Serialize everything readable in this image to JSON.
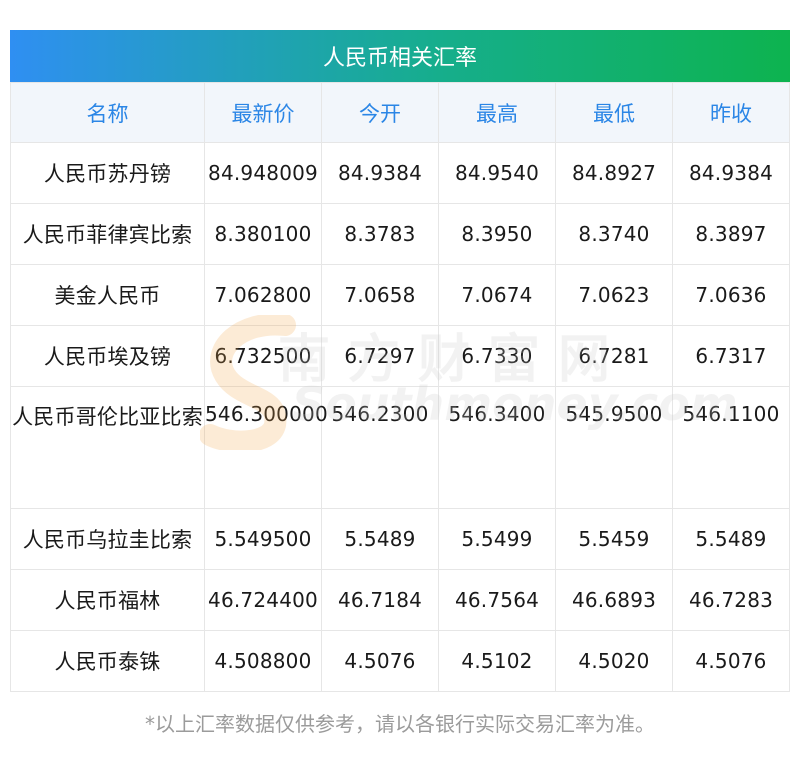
{
  "title": "人民币相关汇率",
  "columns": [
    "名称",
    "最新价",
    "今开",
    "最高",
    "最低",
    "昨收"
  ],
  "rows": [
    {
      "name": "人民币苏丹镑",
      "latest": "84.948009",
      "open": "84.9384",
      "high": "84.9540",
      "low": "84.8927",
      "prev_close": "84.9384"
    },
    {
      "name": "人民币菲律宾比索",
      "latest": "8.380100",
      "open": "8.3783",
      "high": "8.3950",
      "low": "8.3740",
      "prev_close": "8.3897"
    },
    {
      "name": "美金人民币",
      "latest": "7.062800",
      "open": "7.0658",
      "high": "7.0674",
      "low": "7.0623",
      "prev_close": "7.0636"
    },
    {
      "name": "人民币埃及镑",
      "latest": "6.732500",
      "open": "6.7297",
      "high": "6.7330",
      "low": "6.7281",
      "prev_close": "6.7317"
    },
    {
      "name": "人民币哥伦比亚比索",
      "latest": "546.300000",
      "open": "546.2300",
      "high": "546.3400",
      "low": "545.9500",
      "prev_close": "546.1100"
    },
    {
      "name": "人民币乌拉圭比索",
      "latest": "5.549500",
      "open": "5.5489",
      "high": "5.5499",
      "low": "5.5459",
      "prev_close": "5.5489"
    },
    {
      "name": "人民币福林",
      "latest": "46.724400",
      "open": "46.7184",
      "high": "46.7564",
      "low": "46.6893",
      "prev_close": "46.7283"
    },
    {
      "name": "人民币泰铢",
      "latest": "4.508800",
      "open": "4.5076",
      "high": "4.5102",
      "low": "4.5020",
      "prev_close": "4.5076"
    }
  ],
  "footnote": "*以上汇率数据仅供参考，请以各银行实际交易汇率为准。",
  "watermark": {
    "cn": "南方财富网",
    "en": "Southmoney.com"
  },
  "colors": {
    "header_text": "#2b86e6",
    "title_grad_start": "#2f8ff2",
    "title_grad_end": "#0db34f"
  }
}
